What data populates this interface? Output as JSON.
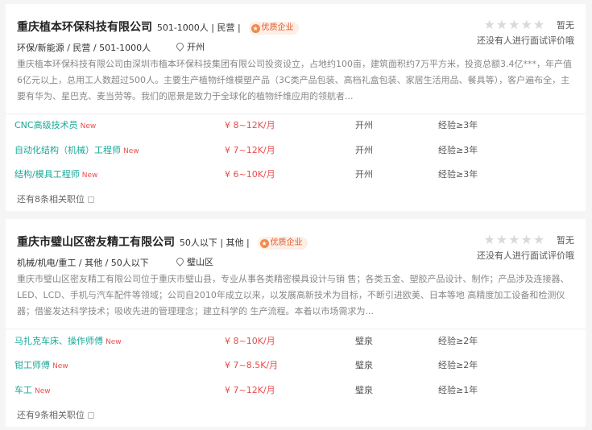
{
  "companies": [
    {
      "name": "重庆植本环保科技有限公司",
      "meta": "501-1000人 | 民营 |",
      "badge": "优质企业",
      "rating_none": "暂无",
      "rating_note": "还没有人进行面试评价哦",
      "tags": "环保/新能源 / 民营 / 501-1000人",
      "location": "开州",
      "description": "重庆植本环保科技有限公司由深圳市植本环保科技集团有限公司投资设立，占地约100亩，建筑面积约7万平方米，投资总额3.4亿***，年产值6亿元以上，总用工人数超过500人。主要生产植物纤维模塑产品（3C类产品包装、高档礼盒包装、家居生活用品、餐具等），客户遍布全，主要有华为、星巴克、麦当劳等。我们的愿景是致力于全球化的植物纤维应用的领航者...",
      "jobs": [
        {
          "title": "CNC高级技术员",
          "new": "New",
          "salary": "¥ 8~12K/月",
          "location": "开州",
          "experience": "经验≥3年"
        },
        {
          "title": "自动化结构（机械）工程师",
          "new": "New",
          "salary": "¥ 7~12K/月",
          "location": "开州",
          "experience": "经验≥3年"
        },
        {
          "title": "结构/模具工程师",
          "new": "New",
          "salary": "¥ 6~10K/月",
          "location": "开州",
          "experience": "经验≥3年"
        }
      ],
      "more": "还有8条相关职位"
    },
    {
      "name": "重庆市璧山区密友精工有限公司",
      "meta": "50人以下 | 其他 |",
      "badge": "优质企业",
      "rating_none": "暂无",
      "rating_note": "还没有人进行面试评价哦",
      "tags": "机械/机电/重工 / 其他 / 50人以下",
      "location": "璧山区",
      "description": "重庆市璧山区密友精工有限公司位于重庆市璧山县，专业从事各类精密模具设计与销 售；各类五金、塑胶产品设计、制作；产品涉及连接器、LED、LCD、手机与汽车配件等领域；公司自2010年成立以来，以发展高新技术为目标，不断引进欧美、日本等地 高精度加工设备和检测仪器；借鉴发达科学技术；吸收先进的管理理念；建立科学的 生产流程。本着以市场需求为...",
      "jobs": [
        {
          "title": "马扎克车床、操作师傅",
          "new": "New",
          "salary": "¥ 8~10K/月",
          "location": "璧泉",
          "experience": "经验≥2年"
        },
        {
          "title": "钳工师傅",
          "new": "New",
          "salary": "¥ 7~8.5K/月",
          "location": "璧泉",
          "experience": "经验≥2年"
        },
        {
          "title": "车工",
          "new": "New",
          "salary": "¥ 7~12K/月",
          "location": "璧泉",
          "experience": "经验≥1年"
        }
      ],
      "more": "还有9条相关职位"
    }
  ],
  "colors": {
    "job_title": "#1aa897",
    "salary": "#e84e4e",
    "badge": "#e05a2a"
  },
  "icons": {
    "badge": "medal-icon",
    "location": "map-pin-icon",
    "star": "star-icon",
    "more": "list-icon"
  }
}
